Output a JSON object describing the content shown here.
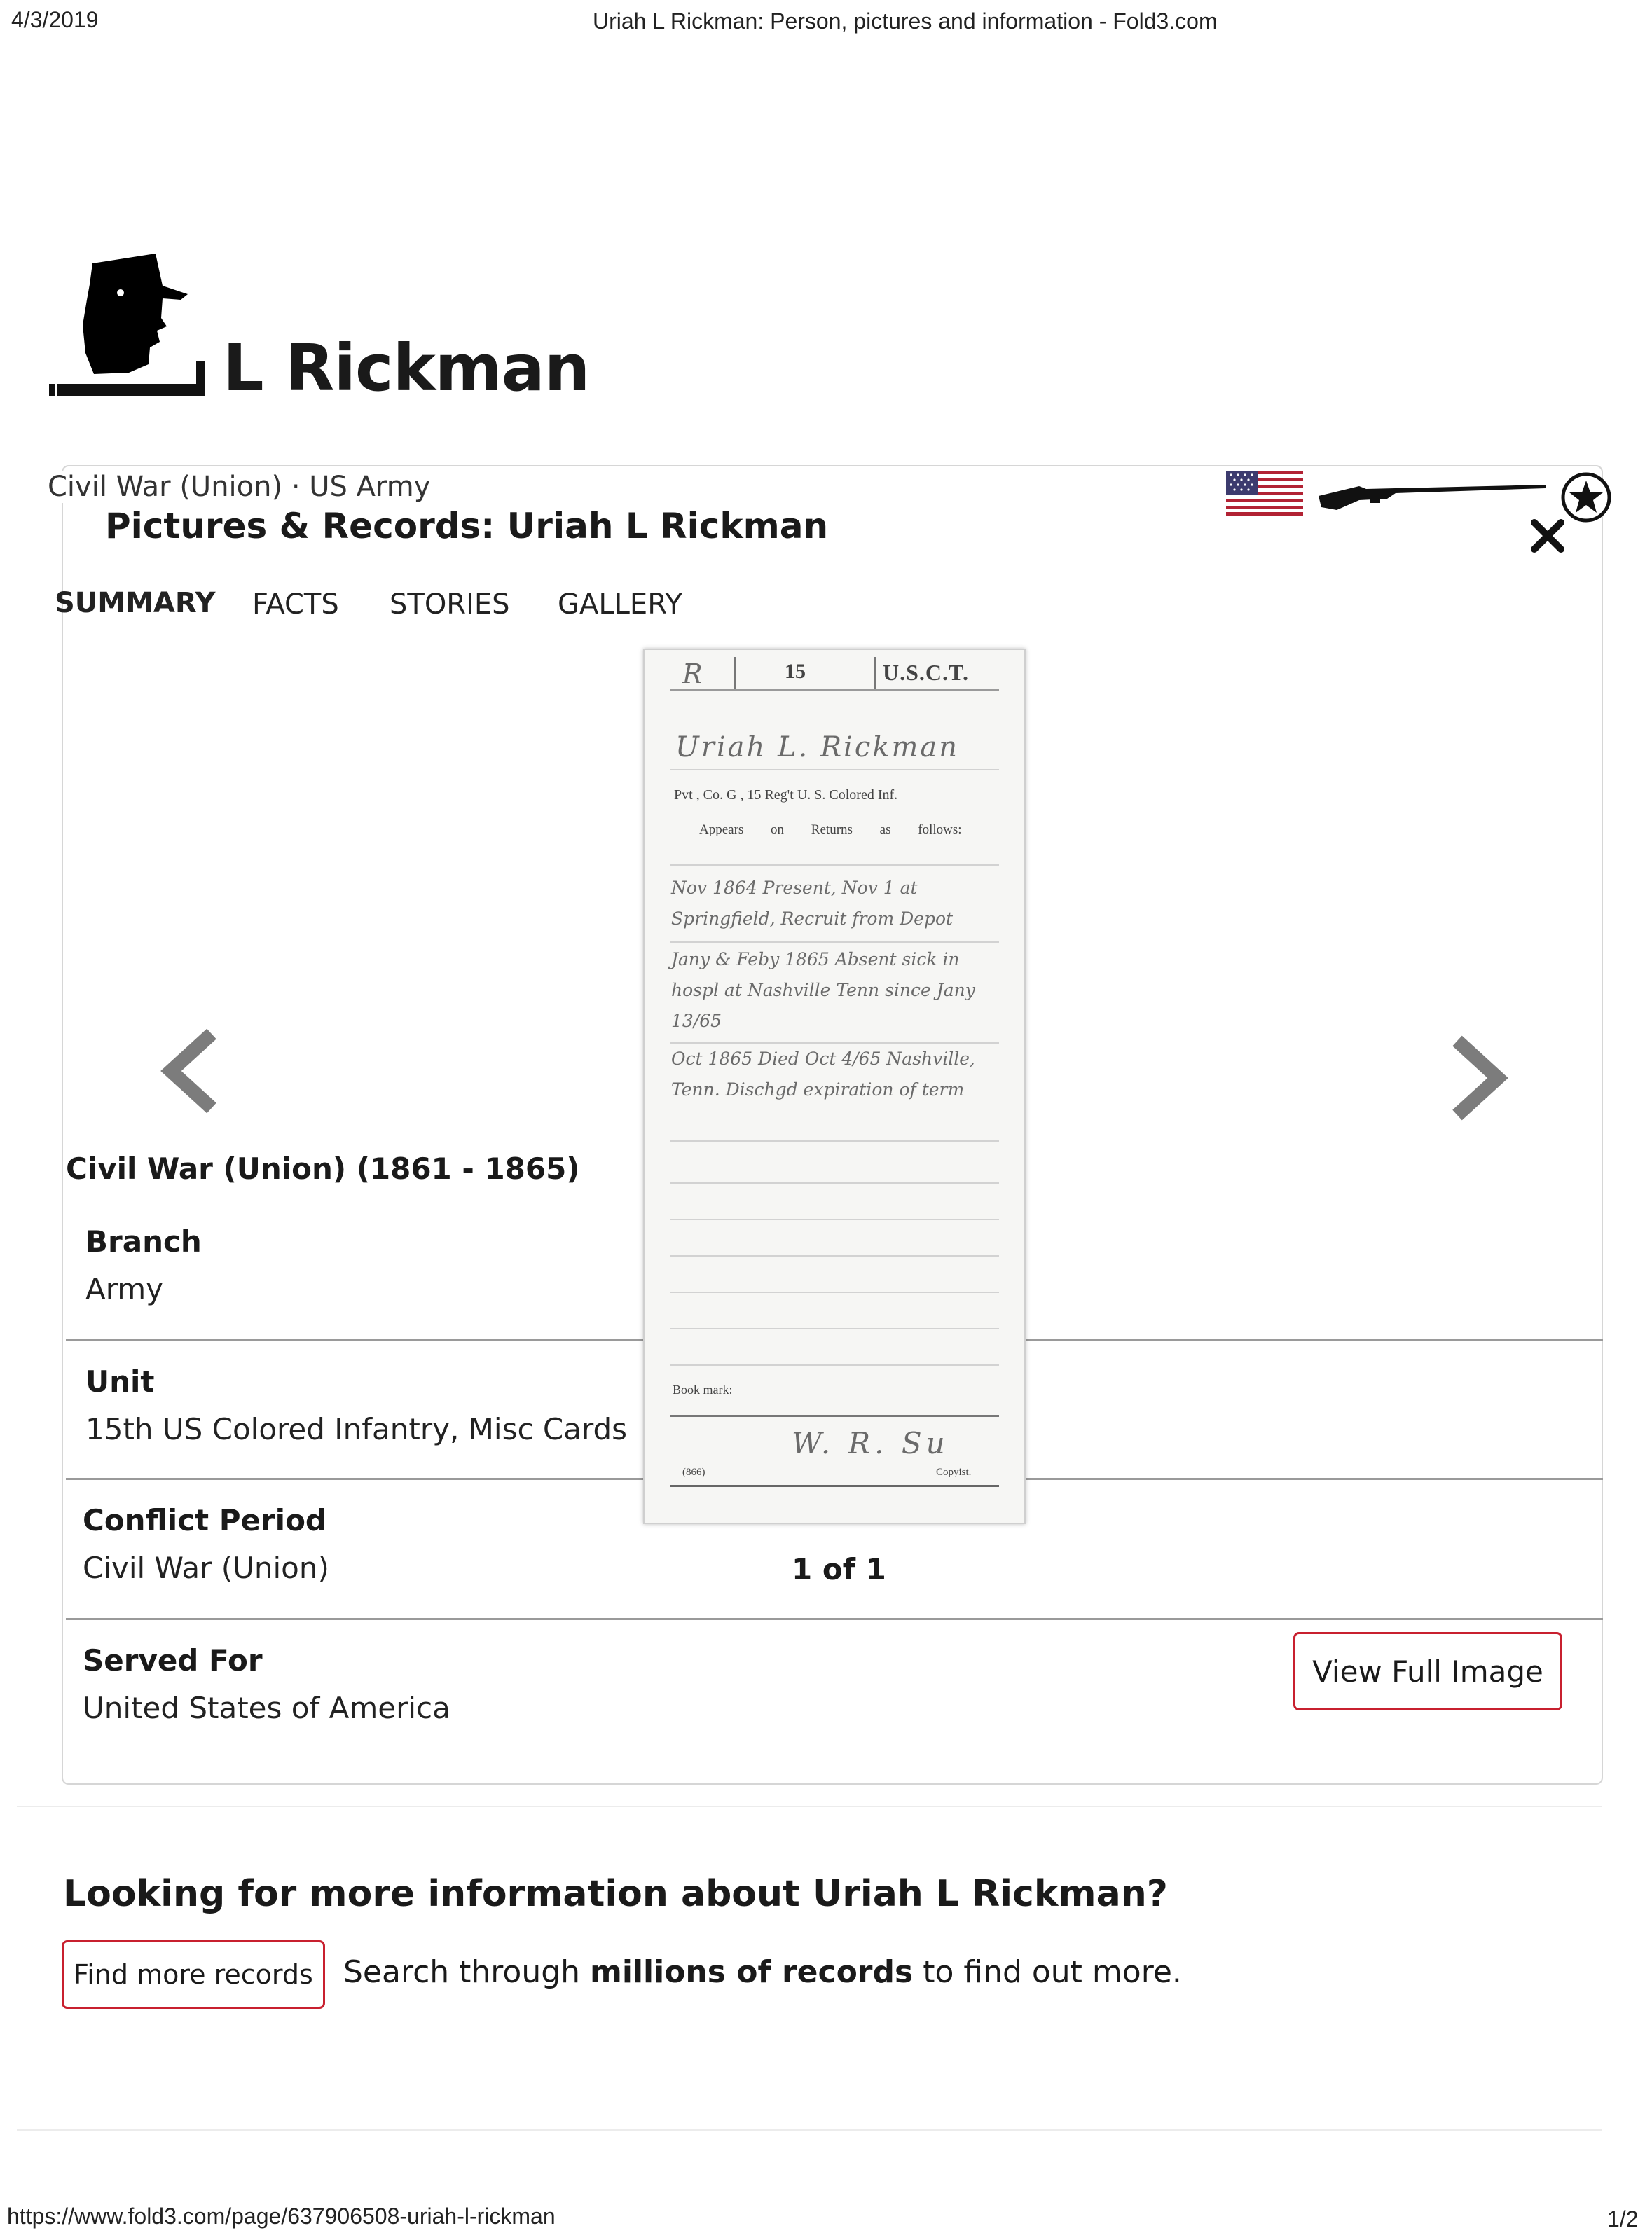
{
  "print_header": {
    "date": "4/3/2019",
    "title": "Uriah L Rickman: Person, pictures and information - Fold3.com"
  },
  "print_footer": {
    "url": "https://www.fold3.com/page/637906508-uriah-l-rickman",
    "page": "1/2"
  },
  "profile": {
    "name_visible": "L Rickman",
    "subtitle": "Civil War (Union) · US Army"
  },
  "modal": {
    "title": "Pictures & Records: Uriah L Rickman",
    "close_icon": "close-icon",
    "tabs": [
      {
        "label": "SUMMARY",
        "active": true
      },
      {
        "label": "FACTS",
        "active": false
      },
      {
        "label": "STORIES",
        "active": false
      },
      {
        "label": "GALLERY",
        "active": false
      }
    ],
    "section_title": "Civil War (Union) (1861 - 1865)",
    "facts": [
      {
        "label": "Branch",
        "value": "Army"
      },
      {
        "label": "Unit",
        "value": "15th US Colored Infantry, Misc Cards"
      },
      {
        "label": "Conflict Period",
        "value": "Civil War (Union)"
      },
      {
        "label": "Served For",
        "value": "United States of America"
      }
    ],
    "image_counter": "1 of 1",
    "view_full_image_label": "View Full Image",
    "record_card": {
      "regiment_number": "15",
      "regiment_abbrev": "U.S.C.T.",
      "corner_mark": "R",
      "name_handwritten": "Uriah L. Rickman",
      "rank_line": "Pvt , Co. G , 15 Reg't U. S. Colored Inf.",
      "appears_on_line": "Appears on Returns as follows:",
      "entries": [
        "Nov 1864 Present, Nov 1 at Springfield, Recruit from Depot",
        "Jany & Feby 1865 Absent sick in hospl at Nashville Tenn since Jany 13/65",
        "Oct 1865 Died Oct 4/65 Nashville, Tenn. Dischgd expiration of term"
      ],
      "book_mark_label": "Book mark:",
      "signature": "W. R. Su",
      "year_label": "(866)",
      "copyist_label": "Copyist."
    },
    "icons": {
      "flag": "us-flag-icon",
      "rifle": "rifle-icon",
      "badge": "star-badge-icon",
      "prev": "chevron-left-icon",
      "next": "chevron-right-icon"
    }
  },
  "more_info": {
    "heading": "Looking for more information about Uriah L Rickman?",
    "button_label": "Find more records",
    "text_before": "Search through ",
    "text_bold": "millions of records",
    "text_after": " to find out more."
  },
  "colors": {
    "accent_red": "#c8202f",
    "divider_gray": "#9a9a9a",
    "panel_border": "#d6d6d6"
  }
}
